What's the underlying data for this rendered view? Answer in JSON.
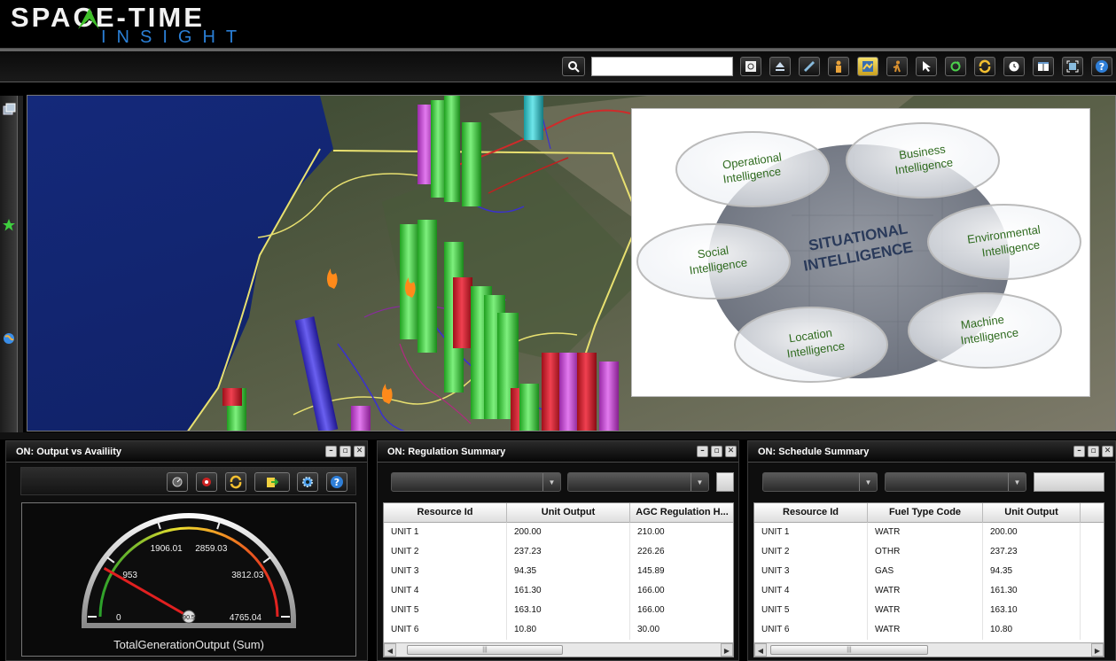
{
  "brand": {
    "line1": "SPACE-TIME",
    "line2": "INSIGHT",
    "accent_green": "#3fbf2a",
    "accent_blue": "#2a7fd6"
  },
  "toolbar": {
    "search_placeholder": "",
    "buttons": [
      "search-zoom-icon",
      "eject-icon",
      "ruler-icon",
      "person-icon",
      "map-layers-icon",
      "walker-icon",
      "pointer-icon",
      "refresh-icon",
      "sync-icon",
      "clock-icon",
      "split-view-icon",
      "fullscreen-icon",
      "help-icon"
    ]
  },
  "sidebar": {
    "icons": [
      "windows-icon",
      "star-icon",
      "globe-icon"
    ]
  },
  "intel": {
    "center": [
      "SITUATIONAL",
      "INTELLIGENCE"
    ],
    "bubbles": [
      {
        "l1": "Operational",
        "l2": "Intelligence"
      },
      {
        "l1": "Business",
        "l2": "Intelligence"
      },
      {
        "l1": "Social",
        "l2": "Intelligence"
      },
      {
        "l1": "Environmental",
        "l2": "Intelligence"
      },
      {
        "l1": "Location",
        "l2": "Intelligence"
      },
      {
        "l1": "Machine",
        "l2": "Intelligence"
      }
    ]
  },
  "panels": {
    "output": {
      "title": "ON: Output vs Availiity",
      "gauge": {
        "min": 0,
        "max": 4765.04,
        "value": 790,
        "value_label": "790.56",
        "ticks": [
          "0",
          "953",
          "1906.01",
          "2859.03",
          "3812.03",
          "4765.04"
        ],
        "label": "TotalGenerationOutput (Sum)"
      }
    },
    "regulation": {
      "title": "ON: Regulation Summary",
      "columns": [
        "Resource Id",
        "Unit Output",
        "AGC Regulation H..."
      ],
      "rows": [
        [
          "UNIT 1",
          "200.00",
          "210.00"
        ],
        [
          "UNIT 2",
          "237.23",
          "226.26"
        ],
        [
          "UNIT 3",
          "94.35",
          "145.89"
        ],
        [
          "UNIT 4",
          "161.30",
          "166.00"
        ],
        [
          "UNIT 5",
          "163.10",
          "166.00"
        ],
        [
          "UNIT 6",
          "10.80",
          "30.00"
        ]
      ]
    },
    "schedule": {
      "title": "ON: Schedule Summary",
      "columns": [
        "Resource Id",
        "Fuel Type Code",
        "Unit Output"
      ],
      "rows": [
        [
          "UNIT 1",
          "WATR",
          "200.00"
        ],
        [
          "UNIT 2",
          "OTHR",
          "237.23"
        ],
        [
          "UNIT 3",
          "GAS",
          "94.35"
        ],
        [
          "UNIT 4",
          "WATR",
          "161.30"
        ],
        [
          "UNIT 5",
          "WATR",
          "163.10"
        ],
        [
          "UNIT 6",
          "WATR",
          "10.80"
        ]
      ]
    }
  },
  "window_buttons": {
    "minimize": "–",
    "restore": "▫",
    "close": "✕"
  },
  "scrollbar_grip": "|||"
}
